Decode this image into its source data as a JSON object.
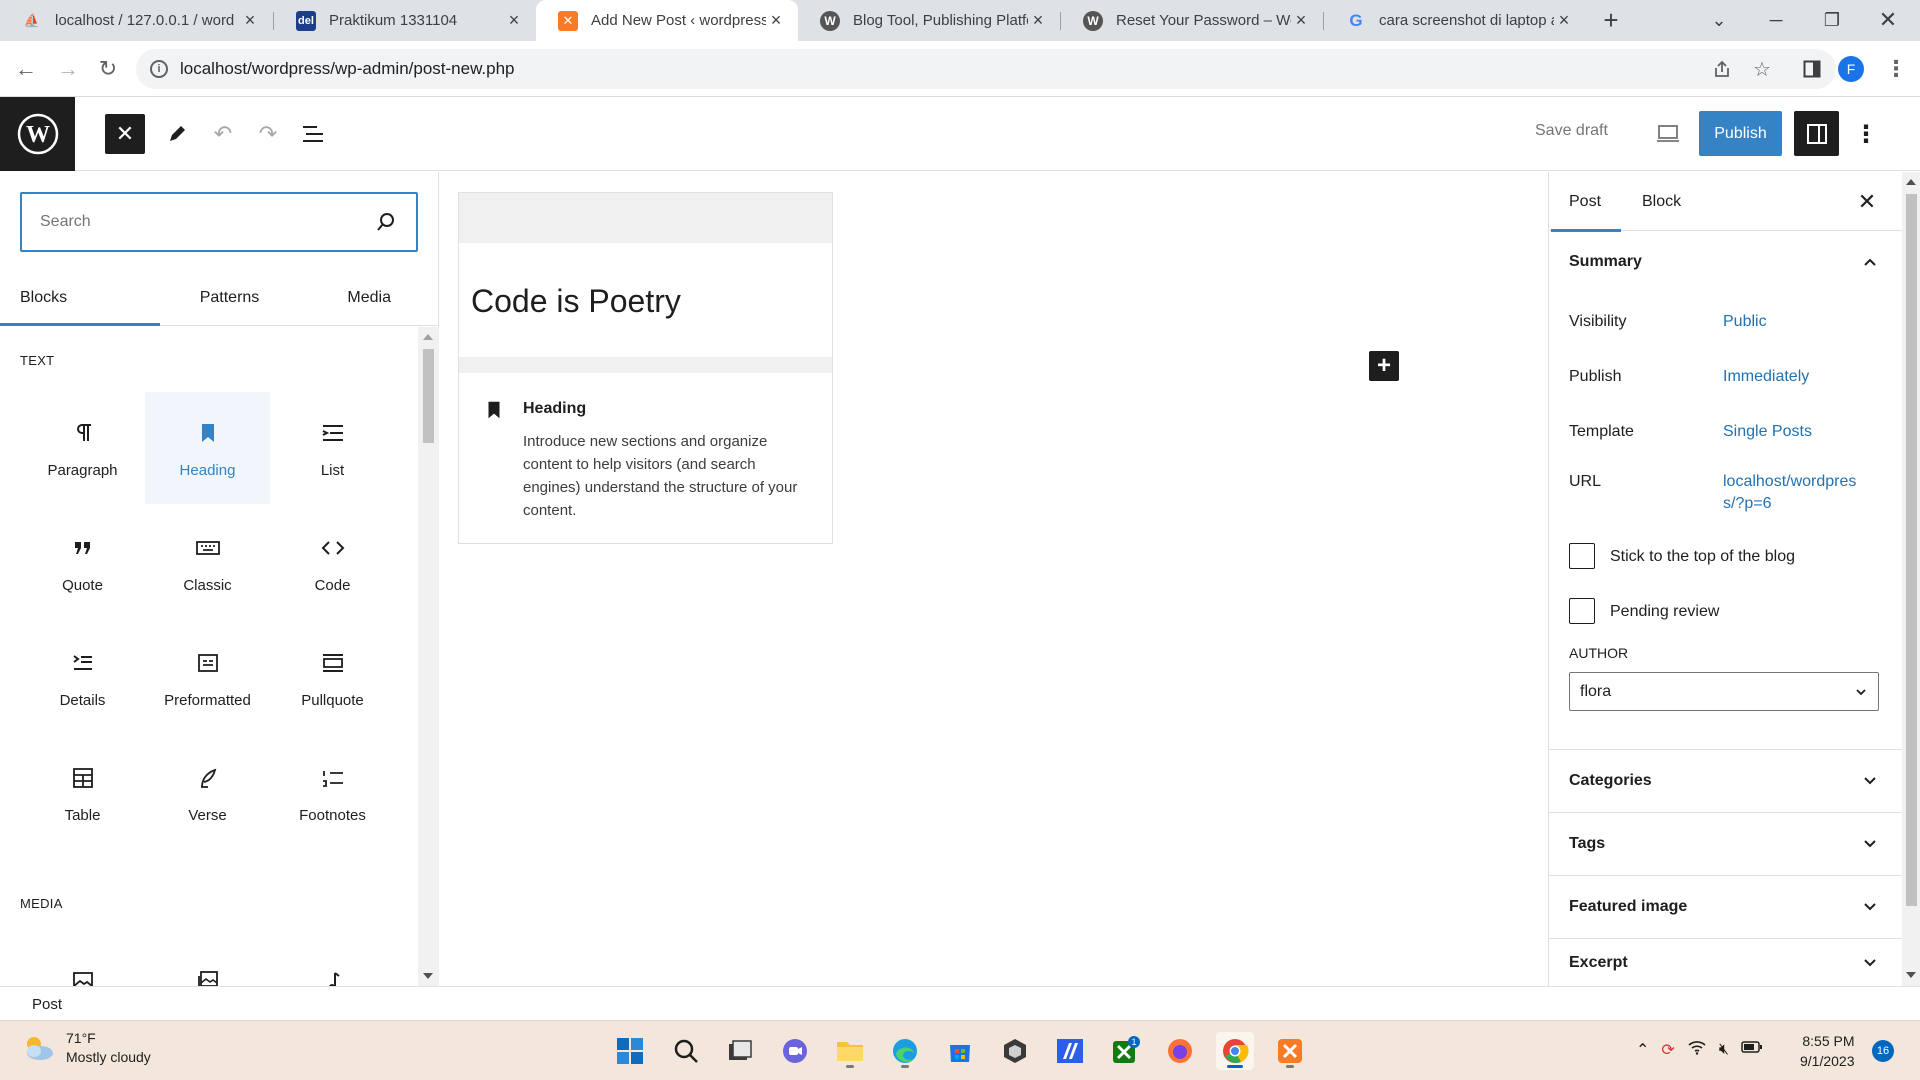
{
  "browser": {
    "tabs": [
      {
        "title": "localhost / 127.0.0.1 / word",
        "favicon": "phpmyadmin-icon"
      },
      {
        "title": "Praktikum 1331104",
        "favicon": "del-icon"
      },
      {
        "title": "Add New Post ‹ wordpress –",
        "favicon": "xampp-icon"
      },
      {
        "title": "Blog Tool, Publishing Platfo",
        "favicon": "wordpress-icon"
      },
      {
        "title": "Reset Your Password – Wor",
        "favicon": "wordpress-icon"
      },
      {
        "title": "cara screenshot di laptop a",
        "favicon": "google-icon"
      }
    ],
    "url": "localhost/wordpress/wp-admin/post-new.php",
    "profile_initial": "F"
  },
  "wp_header": {
    "save_draft": "Save draft",
    "publish": "Publish"
  },
  "inserter": {
    "search_placeholder": "Search",
    "tabs": [
      "Blocks",
      "Patterns",
      "Media"
    ],
    "categories": {
      "text": "TEXT",
      "media": "MEDIA"
    },
    "text_blocks": [
      "Paragraph",
      "Heading",
      "List",
      "Quote",
      "Classic",
      "Code",
      "Details",
      "Preformatted",
      "Pullquote",
      "Table",
      "Verse",
      "Footnotes"
    ]
  },
  "preview": {
    "sample": "Code is Poetry",
    "title": "Heading",
    "description": "Introduce new sections and organize content to help visitors (and search engines) understand the structure of your content."
  },
  "sidebar": {
    "tabs": [
      "Post",
      "Block"
    ],
    "summary": "Summary",
    "rows": {
      "visibility_label": "Visibility",
      "visibility_value": "Public",
      "publish_label": "Publish",
      "publish_value": "Immediately",
      "template_label": "Template",
      "template_value": "Single Posts",
      "url_label": "URL",
      "url_value_1": "localhost/wordpres",
      "url_value_2": "s/?p=6"
    },
    "stick_label": "Stick to the top of the blog",
    "pending_label": "Pending review",
    "author_label": "AUTHOR",
    "author_value": "flora",
    "panels": [
      "Categories",
      "Tags",
      "Featured image",
      "Excerpt"
    ]
  },
  "statusbar": {
    "breadcrumb": "Post"
  },
  "taskbar": {
    "temperature": "71°F",
    "weather": "Mostly cloudy",
    "time": "8:55 PM",
    "date": "9/1/2023",
    "notifications": "16",
    "xbox_badge": "1"
  },
  "colors": {
    "accent": "#3582c4",
    "link": "#2271b1",
    "dark": "#1e1e1e"
  }
}
